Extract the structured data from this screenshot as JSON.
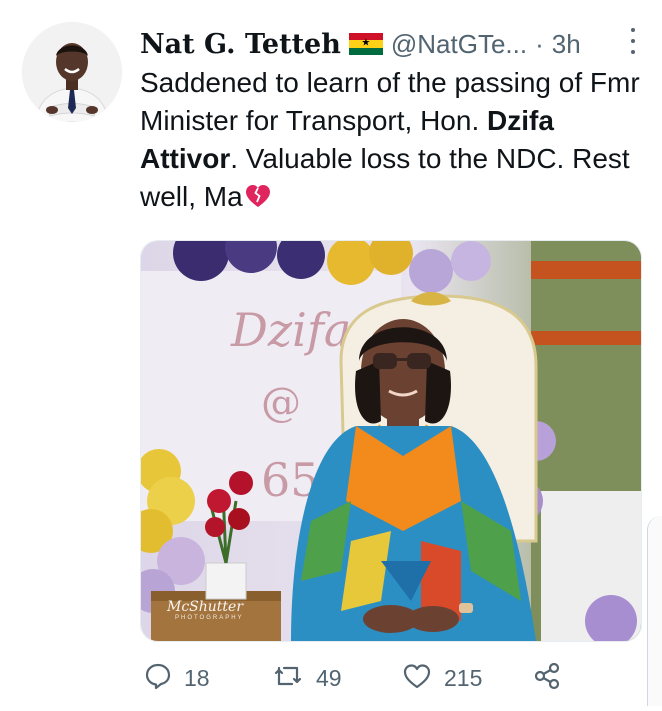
{
  "author": {
    "display_name": "Nat G. Tetteh",
    "handle": "@NatGTe...",
    "separator": "·",
    "time": "3h",
    "flag_icon": "ghana-flag-icon"
  },
  "tweet": {
    "text_part1": "Saddened to learn of the passing of Fmr Minister for Transport, Hon. ",
    "text_bold": "Dzifa Attivor",
    "text_part2": ". Valuable loss to the NDC. Rest well, Ma",
    "emoji": "broken-heart-icon"
  },
  "media": {
    "backdrop_text_1": "Dzifa",
    "backdrop_text_2": "@",
    "backdrop_text_3": "65",
    "watermark": "McShutter",
    "watermark_sub": "PHOTOGRAPHY"
  },
  "actions": {
    "replies": "18",
    "retweets": "49",
    "likes": "215"
  },
  "colors": {
    "text": "#0f1419",
    "secondary": "#536471",
    "ghana_red": "#ce1126",
    "ghana_yellow": "#fcd116",
    "ghana_green": "#006b3f",
    "heart": "#e0245e"
  }
}
